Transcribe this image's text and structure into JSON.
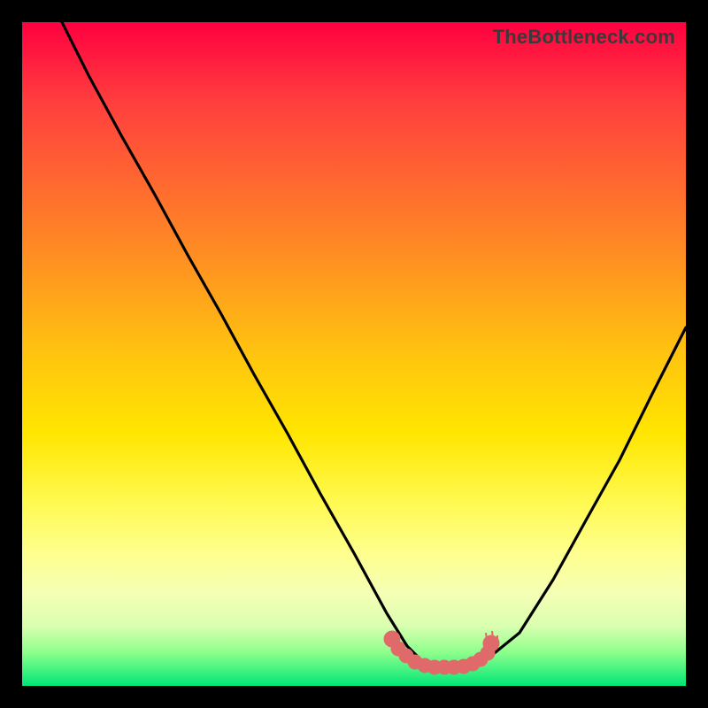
{
  "watermark": "TheBottleneck.com",
  "chart_data": {
    "type": "line",
    "title": "",
    "xlabel": "",
    "ylabel": "",
    "xlim": [
      0,
      100
    ],
    "ylim": [
      0,
      100
    ],
    "grid": false,
    "series": [
      {
        "name": "bottleneck-curve",
        "x": [
          6,
          10,
          15,
          20,
          25,
          30,
          35,
          40,
          45,
          50,
          55,
          58,
          60,
          62,
          65,
          68,
          70,
          75,
          80,
          85,
          90,
          95,
          100
        ],
        "y": [
          100,
          92,
          83,
          74,
          65,
          56,
          47,
          38,
          29,
          20,
          11,
          6,
          4,
          3,
          3,
          3,
          4,
          8,
          16,
          25,
          34,
          44,
          54
        ]
      },
      {
        "name": "highlight-band",
        "x": [
          55,
          70
        ],
        "y": [
          4,
          4
        ]
      }
    ],
    "colors": {
      "curve": "#000000",
      "highlight": "#e06666",
      "gradient_top": "#ff0040",
      "gradient_bottom": "#00e676"
    }
  }
}
